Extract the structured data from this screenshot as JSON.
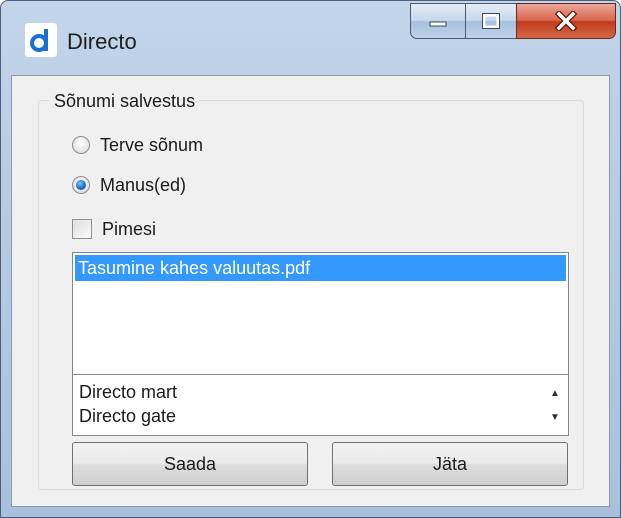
{
  "window": {
    "title": "Directo"
  },
  "groupbox": {
    "label": "Sõnumi salvestus"
  },
  "options": {
    "whole_message": {
      "label": "Terve sõnum",
      "checked": false
    },
    "attachments": {
      "label": "Manus(ed)",
      "checked": true
    },
    "blind": {
      "label": "Pimesi",
      "checked": false
    }
  },
  "attachment_list": [
    {
      "label": "Tasumine kahes valuutas.pdf",
      "selected": true
    }
  ],
  "destination_list": [
    {
      "label": "Directo mart"
    },
    {
      "label": "Directo gate"
    }
  ],
  "buttons": {
    "send": "Saada",
    "cancel": "Jäta"
  },
  "colors": {
    "selection": "#3399ff",
    "close_button": "#c13a1d",
    "radio_dot": "#1f6fc7",
    "app_icon": "#1b6fd1"
  },
  "icons": {
    "app": "directo-logo-icon",
    "minimize": "minimize-icon",
    "maximize": "maximize-icon",
    "close": "close-icon",
    "scroll_up": "scroll-up-icon",
    "scroll_down": "scroll-down-icon"
  }
}
